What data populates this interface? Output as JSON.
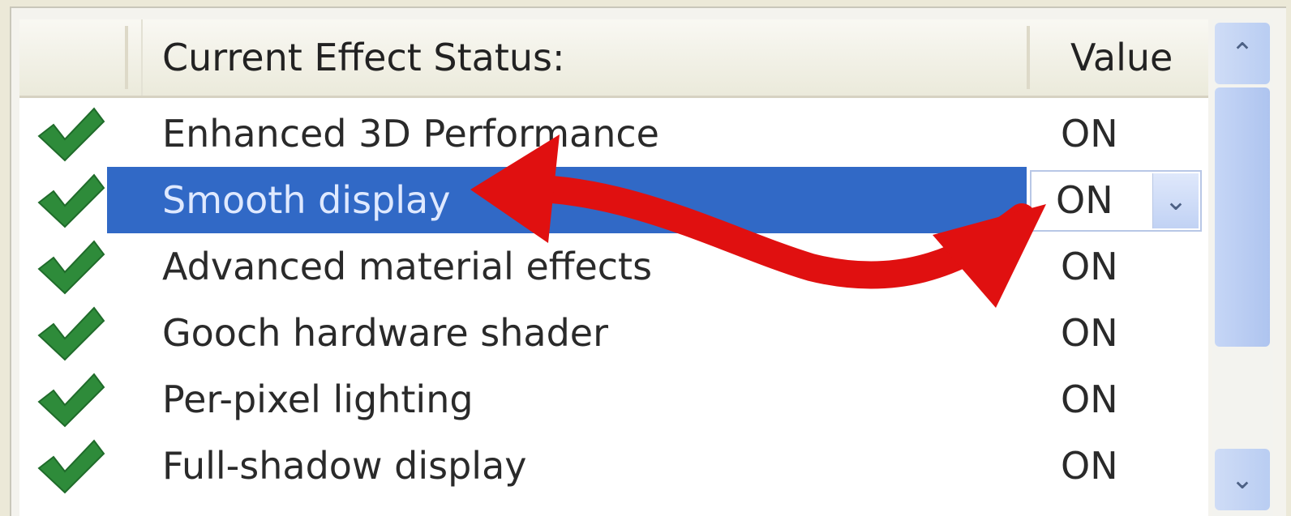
{
  "header": {
    "name_label": "Current Effect Status:",
    "value_label": "Value"
  },
  "rows": [
    {
      "name": "Enhanced 3D Performance",
      "value": "ON",
      "checked": true
    },
    {
      "name": "Smooth display",
      "value": "ON",
      "checked": true,
      "selected": true
    },
    {
      "name": "Advanced material effects",
      "value": "ON",
      "checked": true
    },
    {
      "name": "Gooch hardware shader",
      "value": "ON",
      "checked": true
    },
    {
      "name": "Per-pixel lighting",
      "value": "ON",
      "checked": true
    },
    {
      "name": "Full-shadow display",
      "value": "ON",
      "checked": true
    }
  ],
  "icons": {
    "check": "checkmark-icon",
    "dropdown": "chevron-down-icon",
    "scroll_up": "chevron-up-icon",
    "scroll_down": "chevron-down-icon"
  },
  "colors": {
    "selection": "#3169c6",
    "check": "#2e8b3a",
    "annotation_arrow": "#e01010"
  }
}
